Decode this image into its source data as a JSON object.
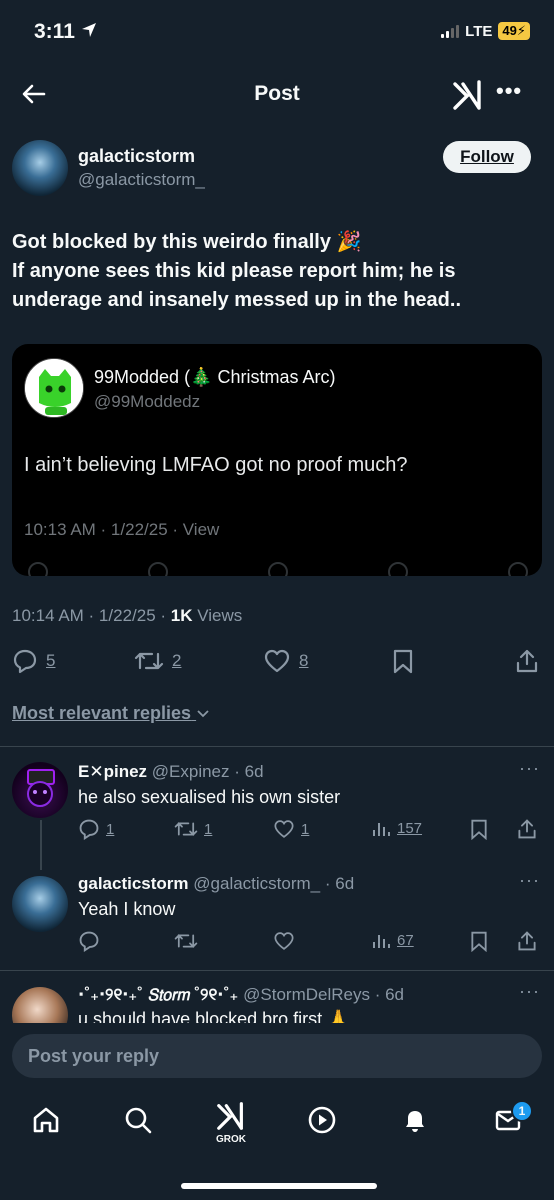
{
  "status_bar": {
    "time": "3:11",
    "network": "LTE",
    "battery": "49"
  },
  "header": {
    "title": "Post",
    "grok_icon": "grok-icon",
    "more_label": "•••"
  },
  "post": {
    "author_name": "galacticstorm",
    "author_handle": "@galacticstorm_",
    "follow_label": "Follow",
    "text_line1": "Got blocked by this weirdo finally 🎉",
    "text_line2": "If anyone sees this kid please report him; he is underage and insanely messed up in the head..",
    "quote": {
      "name": "99Modded (🎄 Christmas Arc)",
      "handle": "@99Moddedz",
      "text": "I ain’t believing LMFAO got no proof much?",
      "meta": "10:13 AM · 1/22/25 · View"
    },
    "time": "10:14 AM · 1/22/25 · ",
    "views_count": "1K",
    "views_label": " Views",
    "stats": {
      "replies": "5",
      "reposts": "2",
      "likes": "8"
    }
  },
  "replies_header": "Most relevant replies",
  "replies": [
    {
      "name": "E✕pinez",
      "handle_time": "@Expinez · 6d",
      "text": "he also sexualised his own sister",
      "replies": "1",
      "reposts": "1",
      "likes": "1",
      "views": "157"
    },
    {
      "name": "galacticstorm",
      "handle_time": "@galacticstorm_ · 6d",
      "text": "Yeah I know",
      "replies": "",
      "reposts": "",
      "likes": "",
      "views": "67"
    },
    {
      "name": "⋅˚₊‧୨୧‧₊˚ 𝘚𝘵𝘰𝘳𝘮 ˚୨୧⋅˚₊",
      "handle_time": "@StormDelReys · 6d",
      "text": "u should have blocked bro first 🙏"
    }
  ],
  "reply_placeholder": "Post your reply",
  "bottom_nav": {
    "grok_label": "GROK",
    "messages_badge": "1"
  },
  "colors": {
    "background": "#15202b",
    "accent": "#1d9bf0",
    "muted": "#8b98a5"
  }
}
